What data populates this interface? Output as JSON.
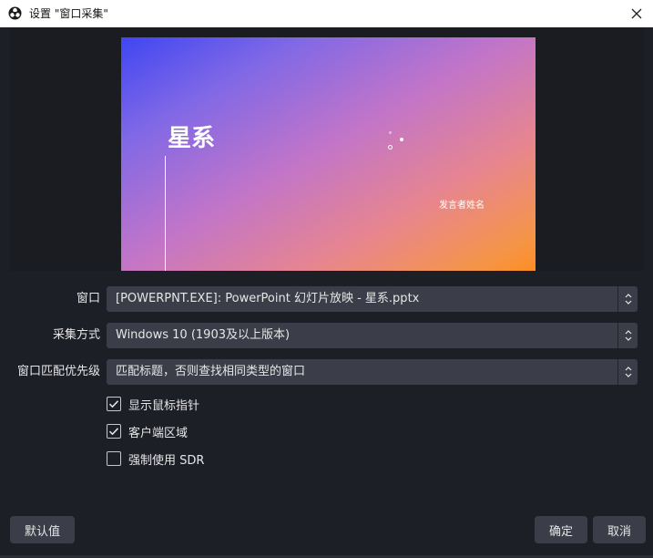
{
  "titlebar": {
    "title": "设置 \"窗口采集\"",
    "app_icon": "obs-logo-icon",
    "close_icon": "close-icon"
  },
  "preview": {
    "slide_title": "星系",
    "slide_author": "发言者姓名",
    "gradient_colors": [
      "#3f46f2",
      "#c275c8",
      "#fd8d23"
    ]
  },
  "form": {
    "window": {
      "label": "窗口",
      "value": "[POWERPNT.EXE]: PowerPoint 幻灯片放映  -  星系.pptx"
    },
    "capture_method": {
      "label": "采集方式",
      "value": "Windows 10 (1903及以上版本)"
    },
    "match_priority": {
      "label": "窗口匹配优先级",
      "value": "匹配标题，否则查找相同类型的窗口"
    }
  },
  "checkboxes": [
    {
      "label": "显示鼠标指针",
      "checked": true
    },
    {
      "label": "客户端区域",
      "checked": true
    },
    {
      "label": "强制使用 SDR",
      "checked": false
    }
  ],
  "buttons": {
    "defaults": "默认值",
    "ok": "确定",
    "cancel": "取消"
  },
  "colors": {
    "background": "#1d1f26",
    "control": "#3b3e49",
    "text": "#e6e6e6"
  }
}
